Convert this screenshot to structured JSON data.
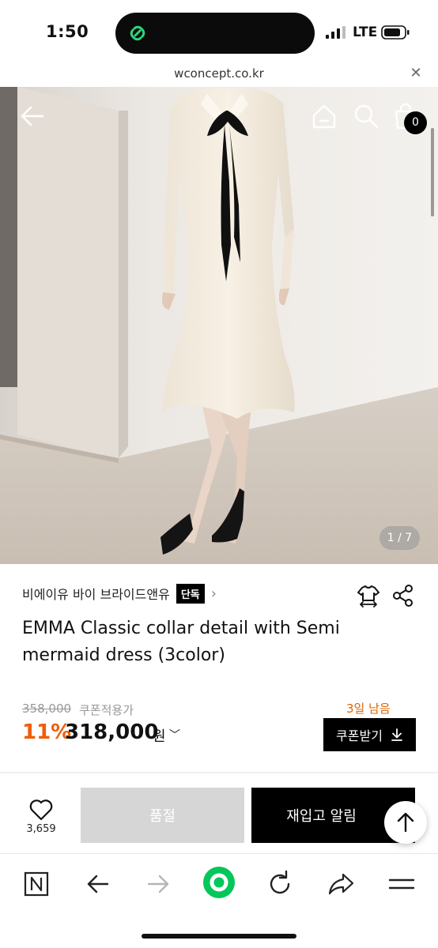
{
  "status_bar": {
    "time": "1:50",
    "network": "LTE"
  },
  "browser": {
    "url": "wconcept.co.kr"
  },
  "hero": {
    "cart_count": "0",
    "pager": "1 / 7"
  },
  "product": {
    "brand": "비에이유 바이 브라이드앤유",
    "exclusive_tag": "단독",
    "title": "EMMA Classic collar detail with Semi mermaid dress (3color)",
    "original_price": "358,000",
    "coupon_price_note": "쿠폰적용가",
    "days_left": "3일 남음",
    "discount": "11%",
    "price": "318,000",
    "price_unit": "원",
    "coupon_button": "쿠폰받기"
  },
  "buy_bar": {
    "like_count": "3,659",
    "soldout_label": "품절",
    "restock_label": "재입고 알림"
  },
  "colors": {
    "accent_orange": "#ef5d07",
    "naver_green": "#03c75a",
    "black": "#000000",
    "soldout_gray": "#d6d6d6"
  },
  "icons": [
    "back-arrow-icon",
    "home-icon",
    "search-icon",
    "shopping-bag-icon",
    "hanger-icon",
    "share-icon",
    "heart-icon",
    "arrow-up-icon",
    "naver-n-icon",
    "nav-back-icon",
    "nav-forward-icon",
    "naver-green-button-icon",
    "refresh-icon",
    "nav-share-icon",
    "menu-icon"
  ]
}
